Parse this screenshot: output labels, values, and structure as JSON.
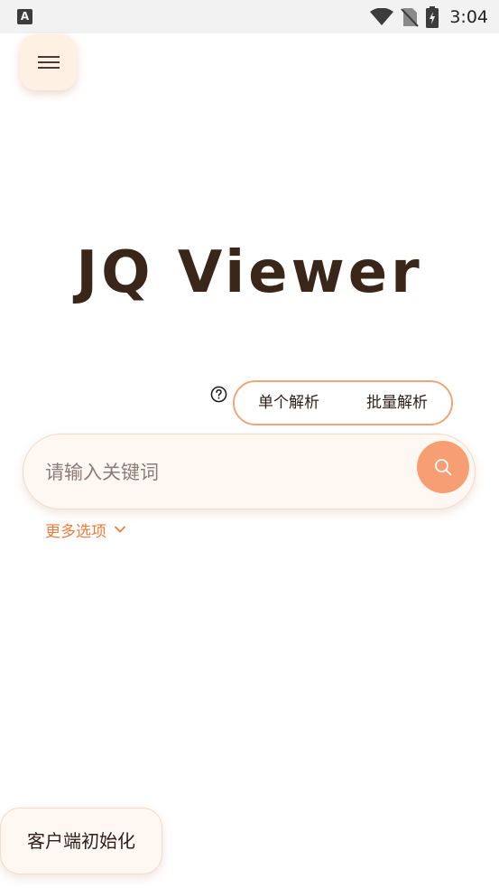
{
  "status_bar": {
    "app_icon": "A",
    "time": "3:04",
    "icons": [
      "wifi-icon",
      "no-sim-icon",
      "battery-charging-icon"
    ]
  },
  "header": {
    "menu_icon": "hamburger-menu-icon"
  },
  "main": {
    "title": "JQ Viewer",
    "help_icon": "help-circle-icon",
    "mode_toggle": {
      "single_label": "单个解析",
      "batch_label": "批量解析"
    },
    "search": {
      "placeholder": "请输入关键词",
      "value": "",
      "button_icon": "search-icon"
    },
    "more_options": {
      "label": "更多选项",
      "icon": "chevron-down-icon"
    }
  },
  "footer": {
    "client_init_label": "客户端初始化"
  },
  "colors": {
    "accent": "#f79e72",
    "accent_text": "#ec7b3f",
    "title": "#3a2519",
    "surface": "#fff7f1"
  }
}
